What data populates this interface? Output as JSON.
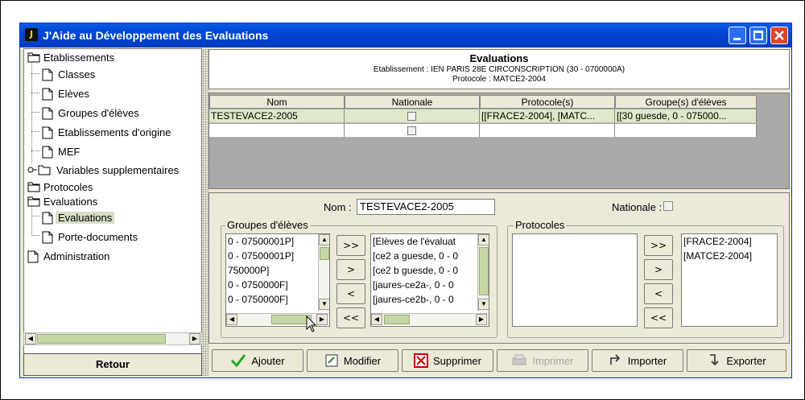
{
  "window": {
    "title": "J'Aide au Développement des Evaluations"
  },
  "sidebar": {
    "items": [
      {
        "label": "Etablissements"
      },
      {
        "label": "Classes"
      },
      {
        "label": "Elèves"
      },
      {
        "label": "Groupes d'élèves"
      },
      {
        "label": "Etablissements d'origine"
      },
      {
        "label": "MEF"
      },
      {
        "label": "Variables supplementaires"
      },
      {
        "label": "Protocoles"
      },
      {
        "label": "Evaluations"
      },
      {
        "label": "Evaluations"
      },
      {
        "label": "Porte-documents"
      },
      {
        "label": "Administration"
      }
    ],
    "back_label": "Retour"
  },
  "header": {
    "title": "Evaluations",
    "line1": "Etablissement : IEN PARIS 28E CIRCONSCRIPTION (30 - 0700000A)",
    "line2": "Protocole : MATCE2-2004"
  },
  "table": {
    "columns": [
      "Nom",
      "Nationale",
      "Protocole(s)",
      "Groupe(s) d'élèves"
    ],
    "rows": [
      {
        "nom": "TESTEVACE2-2005",
        "protocoles": "[[FRACE2-2004], [MATC...",
        "groupes": "[[30 guesde, 0 - 075000..."
      },
      {
        "nom": "",
        "protocoles": "",
        "groupes": ""
      }
    ]
  },
  "form": {
    "nom_label": "Nom :",
    "nom_value": "TESTEVACE2-2005",
    "nationale_label": "Nationale :",
    "groupes_legend": "Groupes d'élèves",
    "groupes_available": [
      "0 - 07500001P]",
      "0 - 07500001P]",
      "750000P]",
      "0 - 0750000F]",
      "0 - 0750000F]"
    ],
    "groupes_selected": [
      "[Elèves de l'évaluat",
      "[ce2 a guesde, 0 - 0",
      "[ce2 b guesde, 0 - 0",
      "[jaures-ce2a-, 0 - 0",
      "[jaures-ce2b-, 0 - 0"
    ],
    "protocoles_legend": "Protocoles",
    "protocoles_available": [],
    "protocoles_selected": [
      "[FRACE2-2004]",
      "[MATCE2-2004]"
    ],
    "move_buttons": {
      "all_right": ">>",
      "right": ">",
      "left": "<",
      "all_left": "<<"
    }
  },
  "toolbar": {
    "add": "Ajouter",
    "modify": "Modifier",
    "delete": "Supprimer",
    "print": "Imprimer",
    "import": "Importer",
    "export": "Exporter"
  },
  "colors": {
    "titlebar": "#0046d5",
    "selection": "#d7dfc3",
    "window_bg": "#ece9d8"
  }
}
